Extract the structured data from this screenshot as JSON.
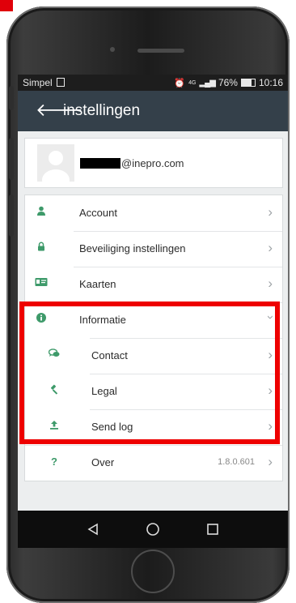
{
  "status_bar": {
    "carrier": "Simpel",
    "carrier_icon": "sim-icon",
    "network": "4G",
    "battery": "76%",
    "battery_level": 0.76,
    "time": "10:16"
  },
  "app_bar": {
    "title": "instellingen",
    "back_icon": "arrow-left-icon"
  },
  "profile": {
    "email_suffix": "@inepro.com"
  },
  "menu": {
    "account": {
      "label": "Account",
      "icon": "user-icon"
    },
    "security": {
      "label": "Beveiliging instellingen",
      "icon": "lock-icon"
    },
    "cards": {
      "label": "Kaarten",
      "icon": "id-card-icon"
    },
    "info": {
      "label": "Informatie",
      "icon": "info-icon",
      "expanded": true,
      "children": {
        "contact": {
          "label": "Contact",
          "icon": "chat-bubbles-icon"
        },
        "legal": {
          "label": "Legal",
          "icon": "gavel-icon"
        },
        "send_log": {
          "label": "Send log",
          "icon": "upload-icon"
        }
      }
    },
    "about": {
      "label": "Over",
      "version": "1.8.0.601",
      "icon": "question-icon"
    }
  },
  "colors": {
    "app_bar": "#34404a",
    "icon_accent": "#3e9a6a",
    "highlight": "#ee0000",
    "background": "#eceeef"
  }
}
